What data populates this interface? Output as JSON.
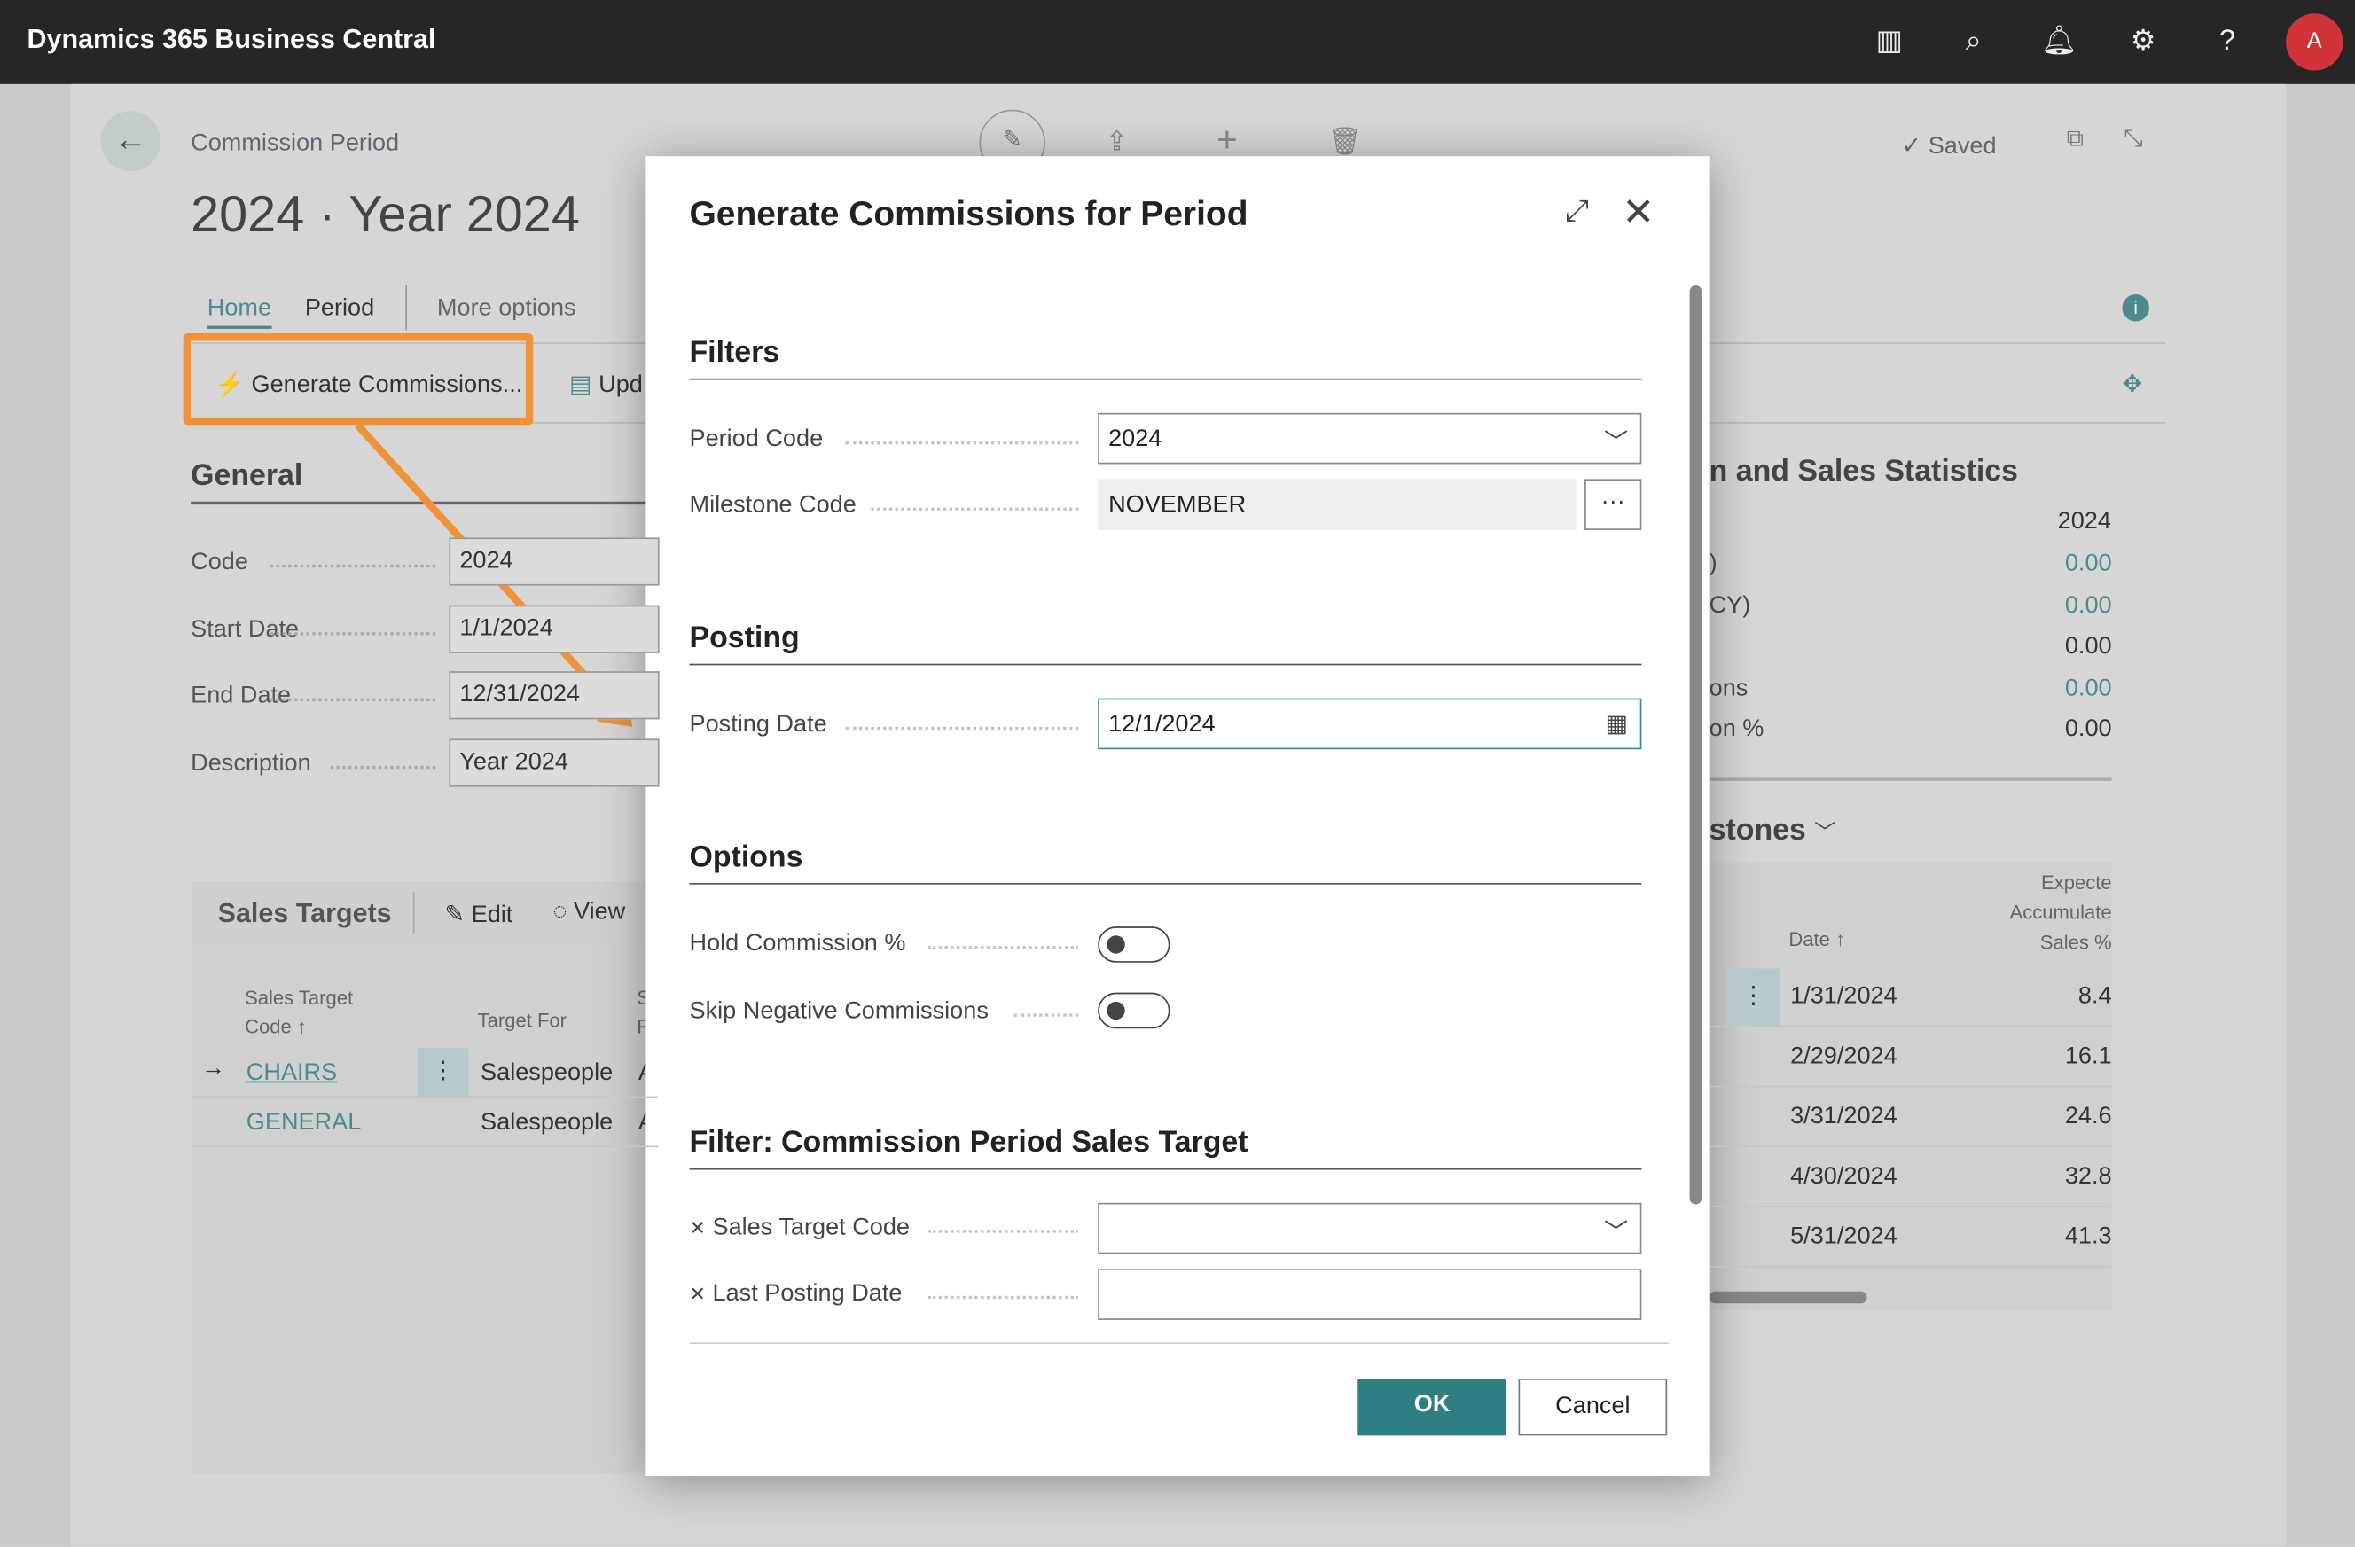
{
  "app": {
    "title": "Dynamics 365 Business Central",
    "avatar_initial": "A",
    "icons": [
      "building-icon",
      "search-icon",
      "bell-icon",
      "gear-icon",
      "help-icon"
    ]
  },
  "page": {
    "breadcrumb": "Commission Period",
    "title": "2024 · Year 2024",
    "saved": "Saved",
    "tabs": [
      "Home",
      "Period",
      "More options"
    ],
    "actions": {
      "generate": "Generate Commissions...",
      "update": "Upd",
      "edit": "Edit",
      "view": "View"
    },
    "general": {
      "heading": "General",
      "fields": [
        {
          "label": "Code",
          "value": "2024"
        },
        {
          "label": "Start Date",
          "value": "1/1/2024"
        },
        {
          "label": "End Date",
          "value": "12/31/2024"
        },
        {
          "label": "Description",
          "value": "Year 2024"
        }
      ]
    },
    "sales_targets": {
      "heading": "Sales Targets",
      "col1a": "Sales Target",
      "col1b": "Code ↑",
      "col2": "Target For",
      "col3a": "S",
      "col3b": "F",
      "rows": [
        {
          "code": "CHAIRS",
          "target_for": "Salespeople",
          "c3": "A"
        },
        {
          "code": "GENERAL",
          "target_for": "Salespeople",
          "c3": "A"
        }
      ]
    },
    "stats": {
      "heading": "n and Sales Statistics",
      "year": "2024",
      "rows": [
        {
          "label": ")",
          "value": "0.00"
        },
        {
          "label": "CY)",
          "value": "0.00"
        },
        {
          "label": "",
          "value": "0.00"
        },
        {
          "label": "ons",
          "value": "0.00"
        },
        {
          "label": "on %",
          "value": "0.00"
        }
      ]
    },
    "milestones": {
      "heading": "stones",
      "col_date": "Date ↑",
      "col_exp1": "Expecte",
      "col_exp2": "Accumulate",
      "col_exp3": "Sales %",
      "rows": [
        {
          "date": "1/31/2024",
          "value": "8.4"
        },
        {
          "date": "2/29/2024",
          "value": "16.1"
        },
        {
          "date": "3/31/2024",
          "value": "24.6"
        },
        {
          "date": "4/30/2024",
          "value": "32.8"
        },
        {
          "date": "5/31/2024",
          "value": "41.3"
        }
      ]
    }
  },
  "dialog": {
    "title": "Generate Commissions for Period",
    "filters": {
      "heading": "Filters",
      "period_code_label": "Period Code",
      "period_code": "2024",
      "milestone_label": "Milestone Code",
      "milestone": "NOVEMBER"
    },
    "posting": {
      "heading": "Posting",
      "date_label": "Posting Date",
      "date": "12/1/2024"
    },
    "options": {
      "heading": "Options",
      "hold_label": "Hold Commission %",
      "hold": false,
      "skip_label": "Skip Negative Commissions",
      "skip": false
    },
    "filter2": {
      "heading": "Filter: Commission Period Sales Target",
      "code_label": "Sales Target Code",
      "code": "",
      "last_label": "Last Posting Date",
      "last": ""
    },
    "ok": "OK",
    "cancel": "Cancel"
  },
  "colors": {
    "accent": "#2f7f82",
    "highlight": "#f0923a",
    "topbar": "#262626"
  }
}
